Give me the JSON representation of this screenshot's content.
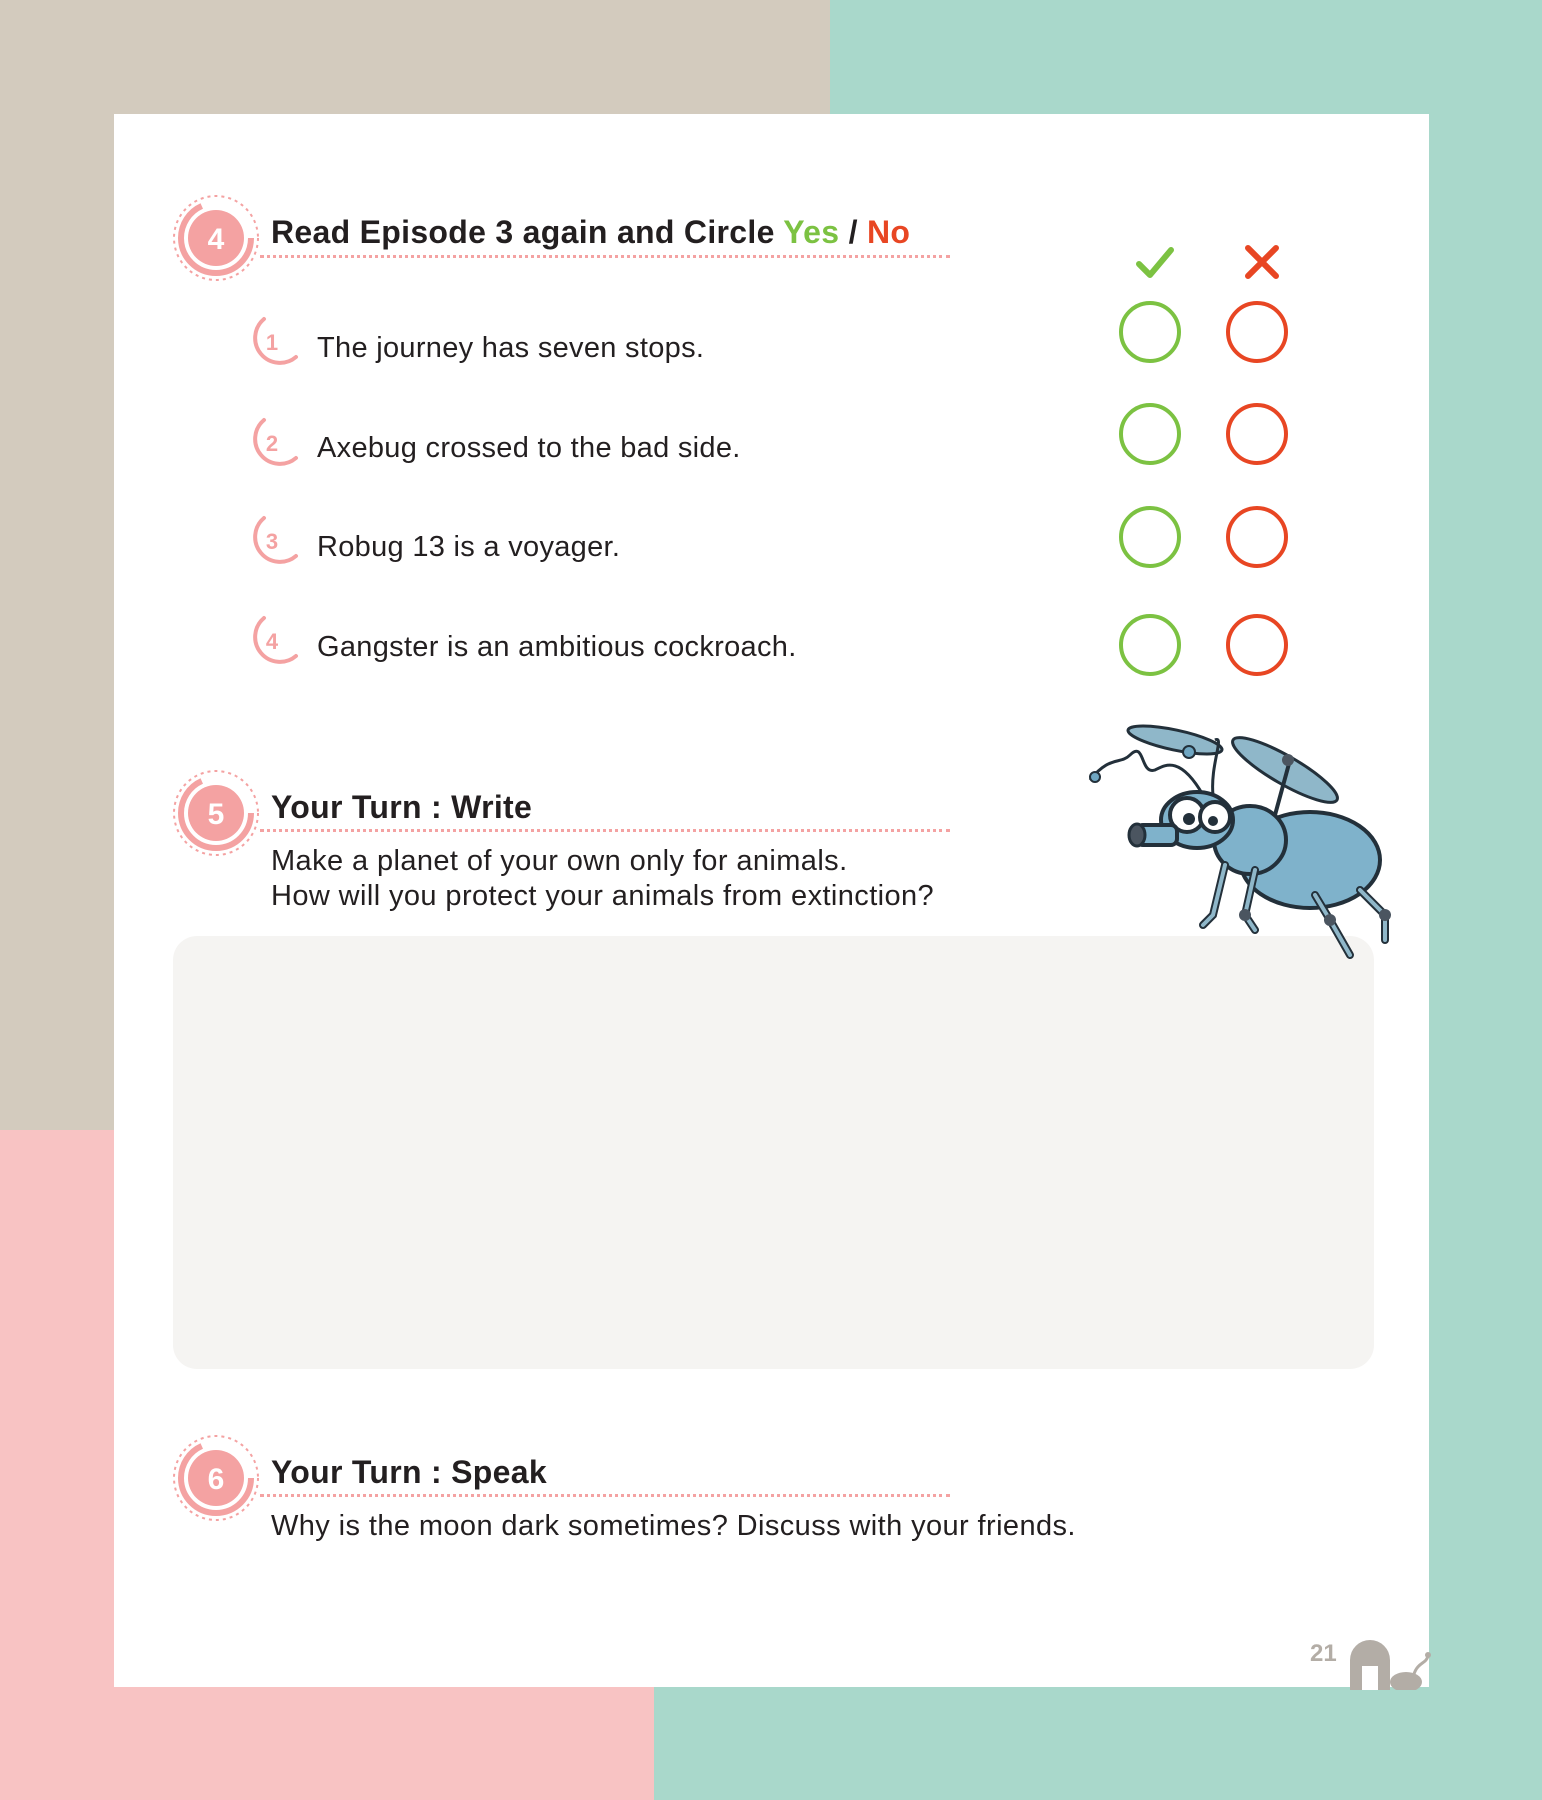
{
  "colors": {
    "yes": "#7cc242",
    "no": "#e84623",
    "badge": "#f4a2a2",
    "beige": "#d3cbbe",
    "mint": "#a9d8cb",
    "pink": "#f8c3c3"
  },
  "section4": {
    "number": "4",
    "title_prefix": "Read Episode 3 again and Circle ",
    "yes_label": "Yes",
    "slash": " / ",
    "no_label": "No",
    "yes_icon": "check-icon",
    "no_icon": "cross-icon",
    "questions": [
      {
        "number": "1",
        "text": "The journey has seven stops."
      },
      {
        "number": "2",
        "text": "Axebug  crossed to the bad side."
      },
      {
        "number": "3",
        "text": "Robug 13 is a voyager."
      },
      {
        "number": "4",
        "text": "Gangster is an ambitious cockroach."
      }
    ]
  },
  "section5": {
    "number": "5",
    "title": "Your Turn : Write",
    "prompt_line1": "Make a planet of your own only for animals.",
    "prompt_line2": "How will you protect your animals from extinction?"
  },
  "section6": {
    "number": "6",
    "title": "Your Turn : Speak",
    "prompt": "Why is the moon dark sometimes? Discuss with your friends."
  },
  "footer": {
    "page_number": "21"
  }
}
